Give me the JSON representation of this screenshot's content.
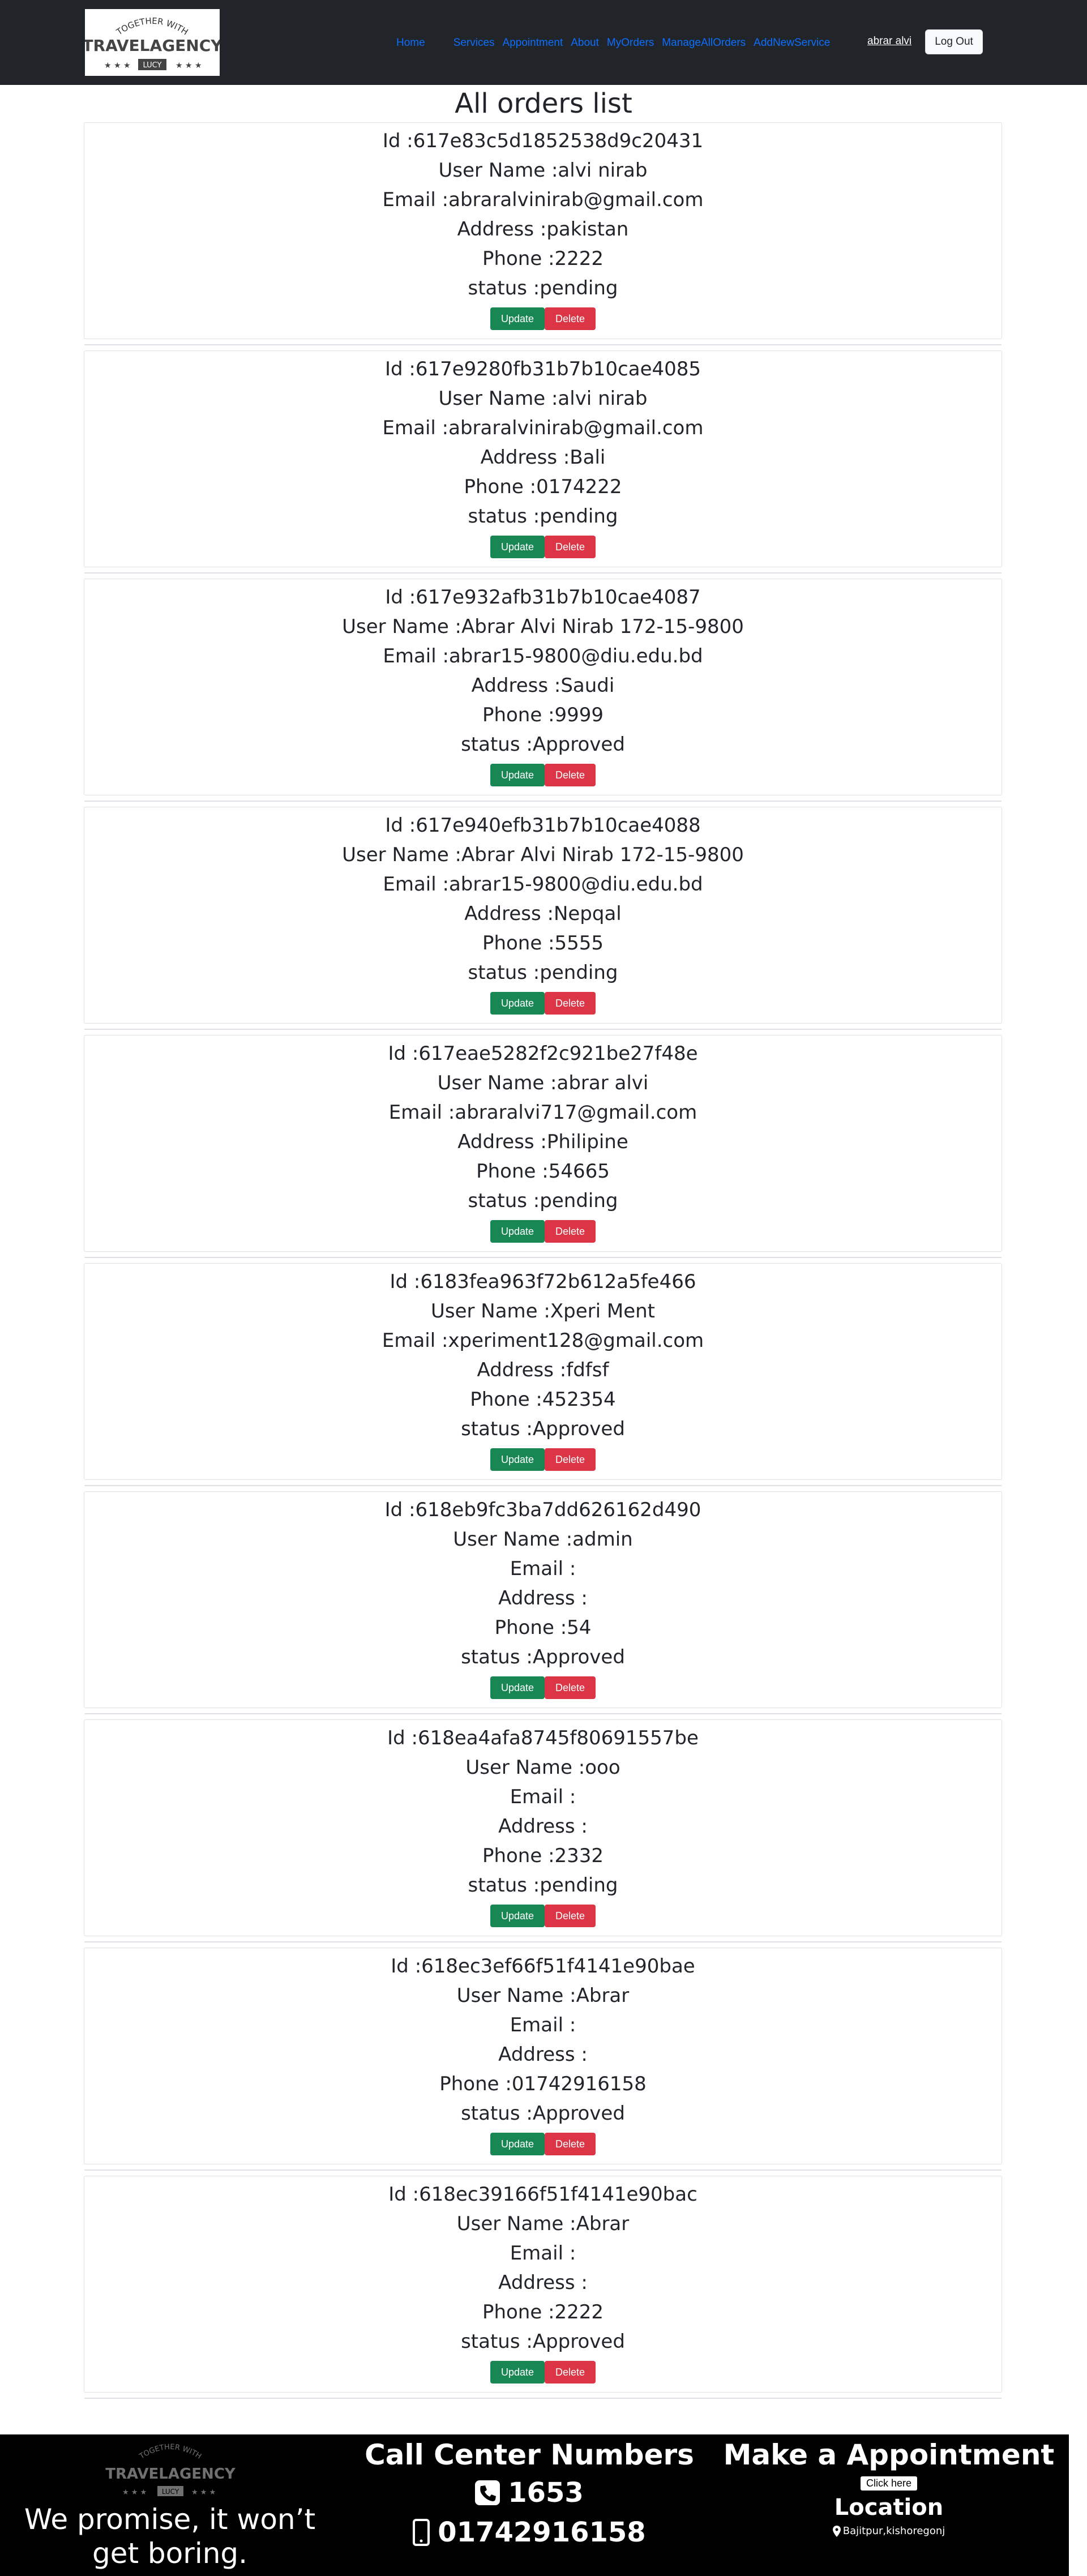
{
  "nav": {
    "logo_top_text": "TOGETHER WITH",
    "logo_brand": "TRAVELAGENCY",
    "logo_badge": "LUCY",
    "links": [
      "Home",
      "Services",
      "Appointment",
      "About",
      "MyOrders",
      "ManageAllOrders",
      "AddNewService"
    ],
    "user_name": "abrar alvi",
    "logout_label": "Log Out"
  },
  "page": {
    "title": "All orders list"
  },
  "labels": {
    "id": "Id :",
    "user_name": "User Name :",
    "email": "Email :",
    "address": "Address :",
    "phone": "Phone :",
    "status": "status :",
    "update_button": "Update",
    "delete_button": "Delete"
  },
  "orders": [
    {
      "id": "617e83c5d1852538d9c20431",
      "user_name": "alvi nirab",
      "email": "abraralvinirab@gmail.com",
      "address": "pakistan",
      "phone": "2222",
      "status": "pending"
    },
    {
      "id": "617e9280fb31b7b10cae4085",
      "user_name": "alvi nirab",
      "email": "abraralvinirab@gmail.com",
      "address": "Bali",
      "phone": "0174222",
      "status": "pending"
    },
    {
      "id": "617e932afb31b7b10cae4087",
      "user_name": "Abrar Alvi Nirab 172-15-9800",
      "email": "abrar15-9800@diu.edu.bd",
      "address": "Saudi",
      "phone": "9999",
      "status": "Approved"
    },
    {
      "id": "617e940efb31b7b10cae4088",
      "user_name": "Abrar Alvi Nirab 172-15-9800",
      "email": "abrar15-9800@diu.edu.bd",
      "address": "Nepqal",
      "phone": "5555",
      "status": "pending"
    },
    {
      "id": "617eae5282f2c921be27f48e",
      "user_name": "abrar alvi",
      "email": "abraralvi717@gmail.com",
      "address": "Philipine",
      "phone": "54665",
      "status": "pending"
    },
    {
      "id": "6183fea963f72b612a5fe466",
      "user_name": "Xperi Ment",
      "email": "xperiment128@gmail.com",
      "address": "fdfsf",
      "phone": "452354",
      "status": "Approved"
    },
    {
      "id": "618eb9fc3ba7dd626162d490",
      "user_name": "admin",
      "email": "",
      "address": "",
      "phone": "54",
      "status": "Approved"
    },
    {
      "id": "618ea4afa8745f80691557be",
      "user_name": "ooo",
      "email": "",
      "address": "",
      "phone": "2332",
      "status": "pending"
    },
    {
      "id": "618ec3ef66f51f4141e90bae",
      "user_name": "Abrar",
      "email": "",
      "address": "",
      "phone": "01742916158",
      "status": "Approved"
    },
    {
      "id": "618ec39166f51f4141e90bac",
      "user_name": "Abrar",
      "email": "",
      "address": "",
      "phone": "2222",
      "status": "Approved"
    }
  ],
  "footer": {
    "logo_brand": "TRAVELAGENCY",
    "logo_badge": "LUCY",
    "tagline": "We promise, it won’t get boring.",
    "call_heading": "Call Center Numbers",
    "phone_1": "1653",
    "phone_2": "01742916158",
    "appointment_heading": "Make a Appointment",
    "click_label": "Click here",
    "location_heading": "Location",
    "location_text": "Bajitpur,kishoregonj"
  }
}
